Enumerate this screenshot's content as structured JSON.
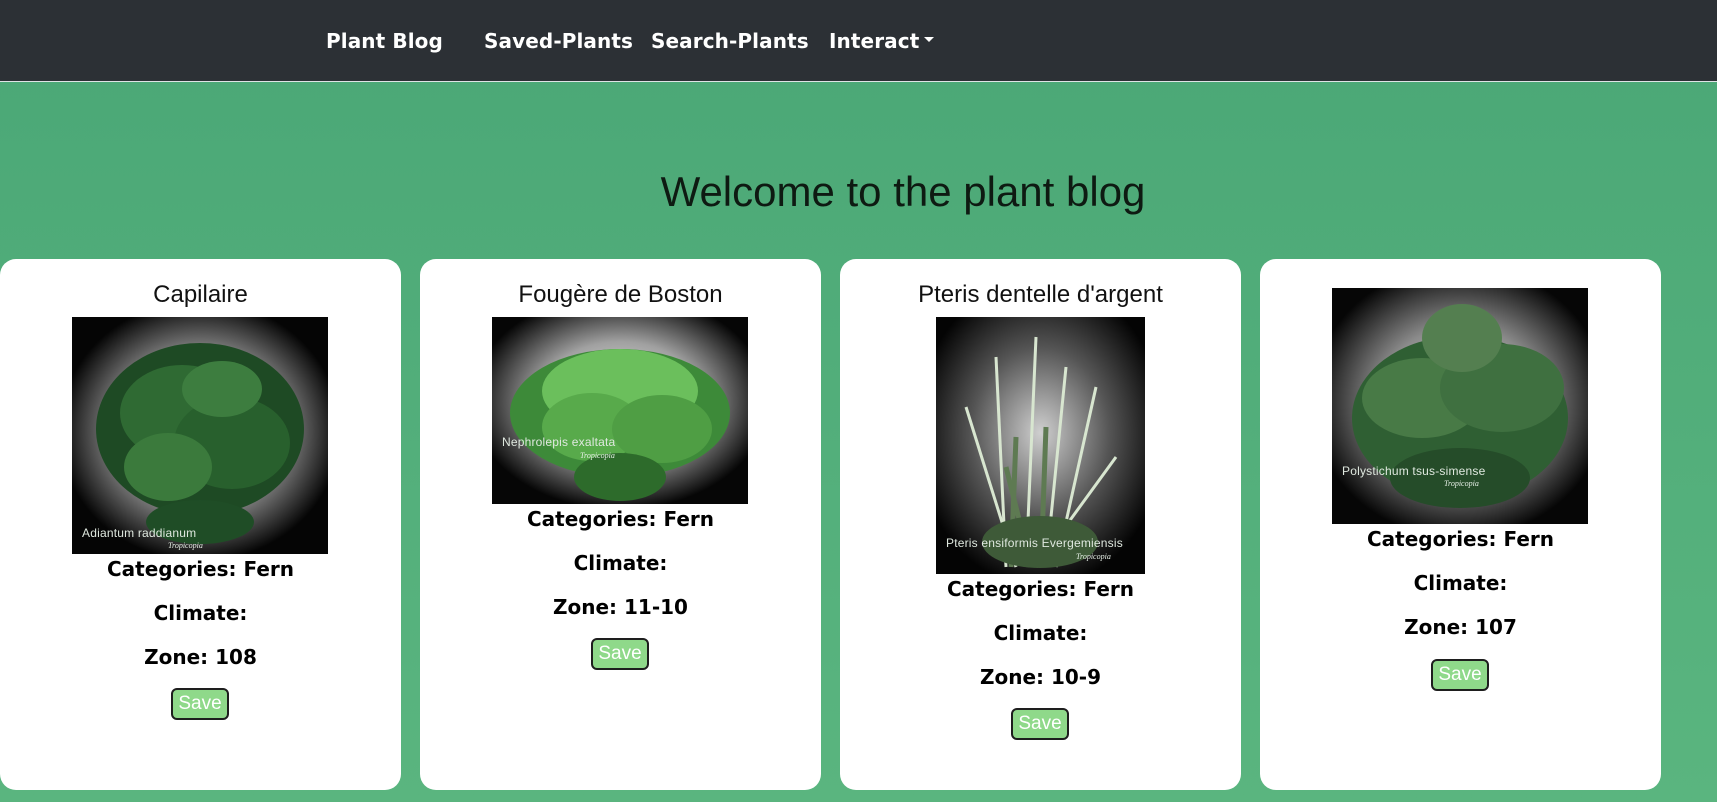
{
  "navbar": {
    "brand": "Plant Blog",
    "links": [
      "Saved-Plants",
      "Search-Plants"
    ],
    "dropdown_label": "Interact"
  },
  "page": {
    "title": "Welcome to the plant blog"
  },
  "colors": {
    "navbar_bg": "#2c3035",
    "page_bg": "#4fab78",
    "save_button": "#8fd98a"
  },
  "cards": [
    {
      "name": "Capilaire",
      "image_caption": "Adiantum raddianum",
      "image_brand": "Tropicopia",
      "categories": "Categories: Fern",
      "climate": "Climate:",
      "zone": "Zone: 108",
      "save_label": "Save"
    },
    {
      "name": "Fougère de Boston",
      "image_caption": "Nephrolepis exaltata",
      "image_brand": "Tropicopia",
      "categories": "Categories: Fern",
      "climate": "Climate:",
      "zone": "Zone: 11-10",
      "save_label": "Save"
    },
    {
      "name": "Pteris dentelle d'argent",
      "image_caption": "Pteris ensiformis Evergemiensis",
      "image_brand": "Tropicopia",
      "categories": "Categories: Fern",
      "climate": "Climate:",
      "zone": "Zone: 10-9",
      "save_label": "Save"
    },
    {
      "name": "",
      "image_caption": "Polystichum tsus-simense",
      "image_brand": "Tropicopia",
      "categories": "Categories: Fern",
      "climate": "Climate:",
      "zone": "Zone: 107",
      "save_label": "Save"
    }
  ]
}
